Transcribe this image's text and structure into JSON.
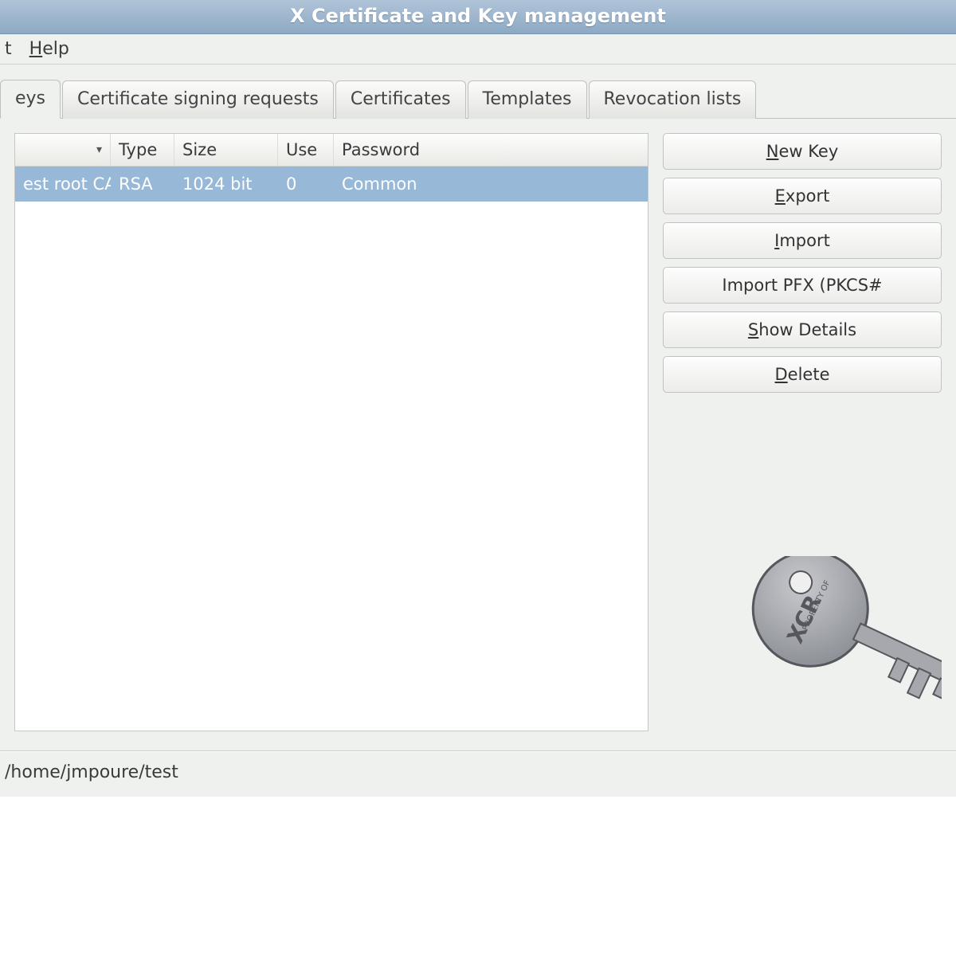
{
  "window": {
    "title": "X Certificate and Key management"
  },
  "menubar": {
    "items": [
      {
        "label_pre": "",
        "label_u": "",
        "label_post": ""
      },
      {
        "label_pre": "",
        "label_u": "H",
        "label_post": "elp"
      }
    ],
    "first_visible_fragment": "t"
  },
  "tabs": [
    {
      "label": "eys",
      "active": true
    },
    {
      "label": "Certificate signing requests",
      "active": false
    },
    {
      "label": "Certificates",
      "active": false
    },
    {
      "label": "Templates",
      "active": false
    },
    {
      "label": "Revocation lists",
      "active": false
    }
  ],
  "columns": {
    "name": "",
    "type": "Type",
    "size": "Size",
    "use": "Use",
    "password": "Password"
  },
  "rows": [
    {
      "name": "est root CA",
      "type": "RSA",
      "size": "1024 bit",
      "use": "0",
      "password": "Common",
      "selected": true
    }
  ],
  "buttons": {
    "new_key": {
      "u": "N",
      "rest": "ew Key"
    },
    "export": {
      "u": "E",
      "rest": "xport"
    },
    "import": {
      "u": "I",
      "rest": "mport"
    },
    "import_pfx": {
      "pre": "Import PFX (PKCS#",
      "u": "",
      "rest": ""
    },
    "show_details": {
      "pre": "",
      "u": "S",
      "rest": "how Details"
    },
    "delete": {
      "pre": "",
      "u": "D",
      "rest": "elete"
    }
  },
  "key_icon": {
    "label_top": "PROPERTY OF",
    "label_main": "XCR"
  },
  "statusbar": {
    "path": "/home/jmpoure/test"
  }
}
